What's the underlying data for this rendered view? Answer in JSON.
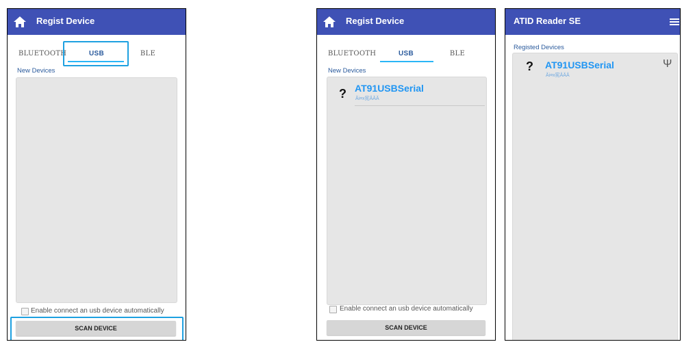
{
  "screen1": {
    "title": "Regist Device",
    "tabs": [
      "BLUETOOTH",
      "USB",
      "BLE"
    ],
    "section_label": "New Devices",
    "checkbox_label": "Enable connect an usb device automatically",
    "scan_button": "SCAN DEVICE"
  },
  "screen2": {
    "title": "Regist Device",
    "tabs": [
      "BLUETOOTH",
      "USB",
      "BLE"
    ],
    "section_label": "New Devices",
    "device": {
      "icon": "?",
      "name": "AT91USBSerial",
      "sub": "Ăi¤x宪ĂĂĂ"
    },
    "checkbox_label": "Enable connect an usb device automatically",
    "scan_button": "SCAN DEVICE"
  },
  "screen3": {
    "title": "ATID Reader SE",
    "section_label": "Registed Devices",
    "device": {
      "icon": "?",
      "name": "AT91USBSerial",
      "sub": "Ăi¤x宪ĂĂĂ",
      "connection_icon": "Ψ"
    }
  },
  "colors": {
    "appbar": "#3f51b5",
    "accent": "#29b6f6",
    "highlight": "#1da0e0",
    "device_name": "#2196f3"
  }
}
